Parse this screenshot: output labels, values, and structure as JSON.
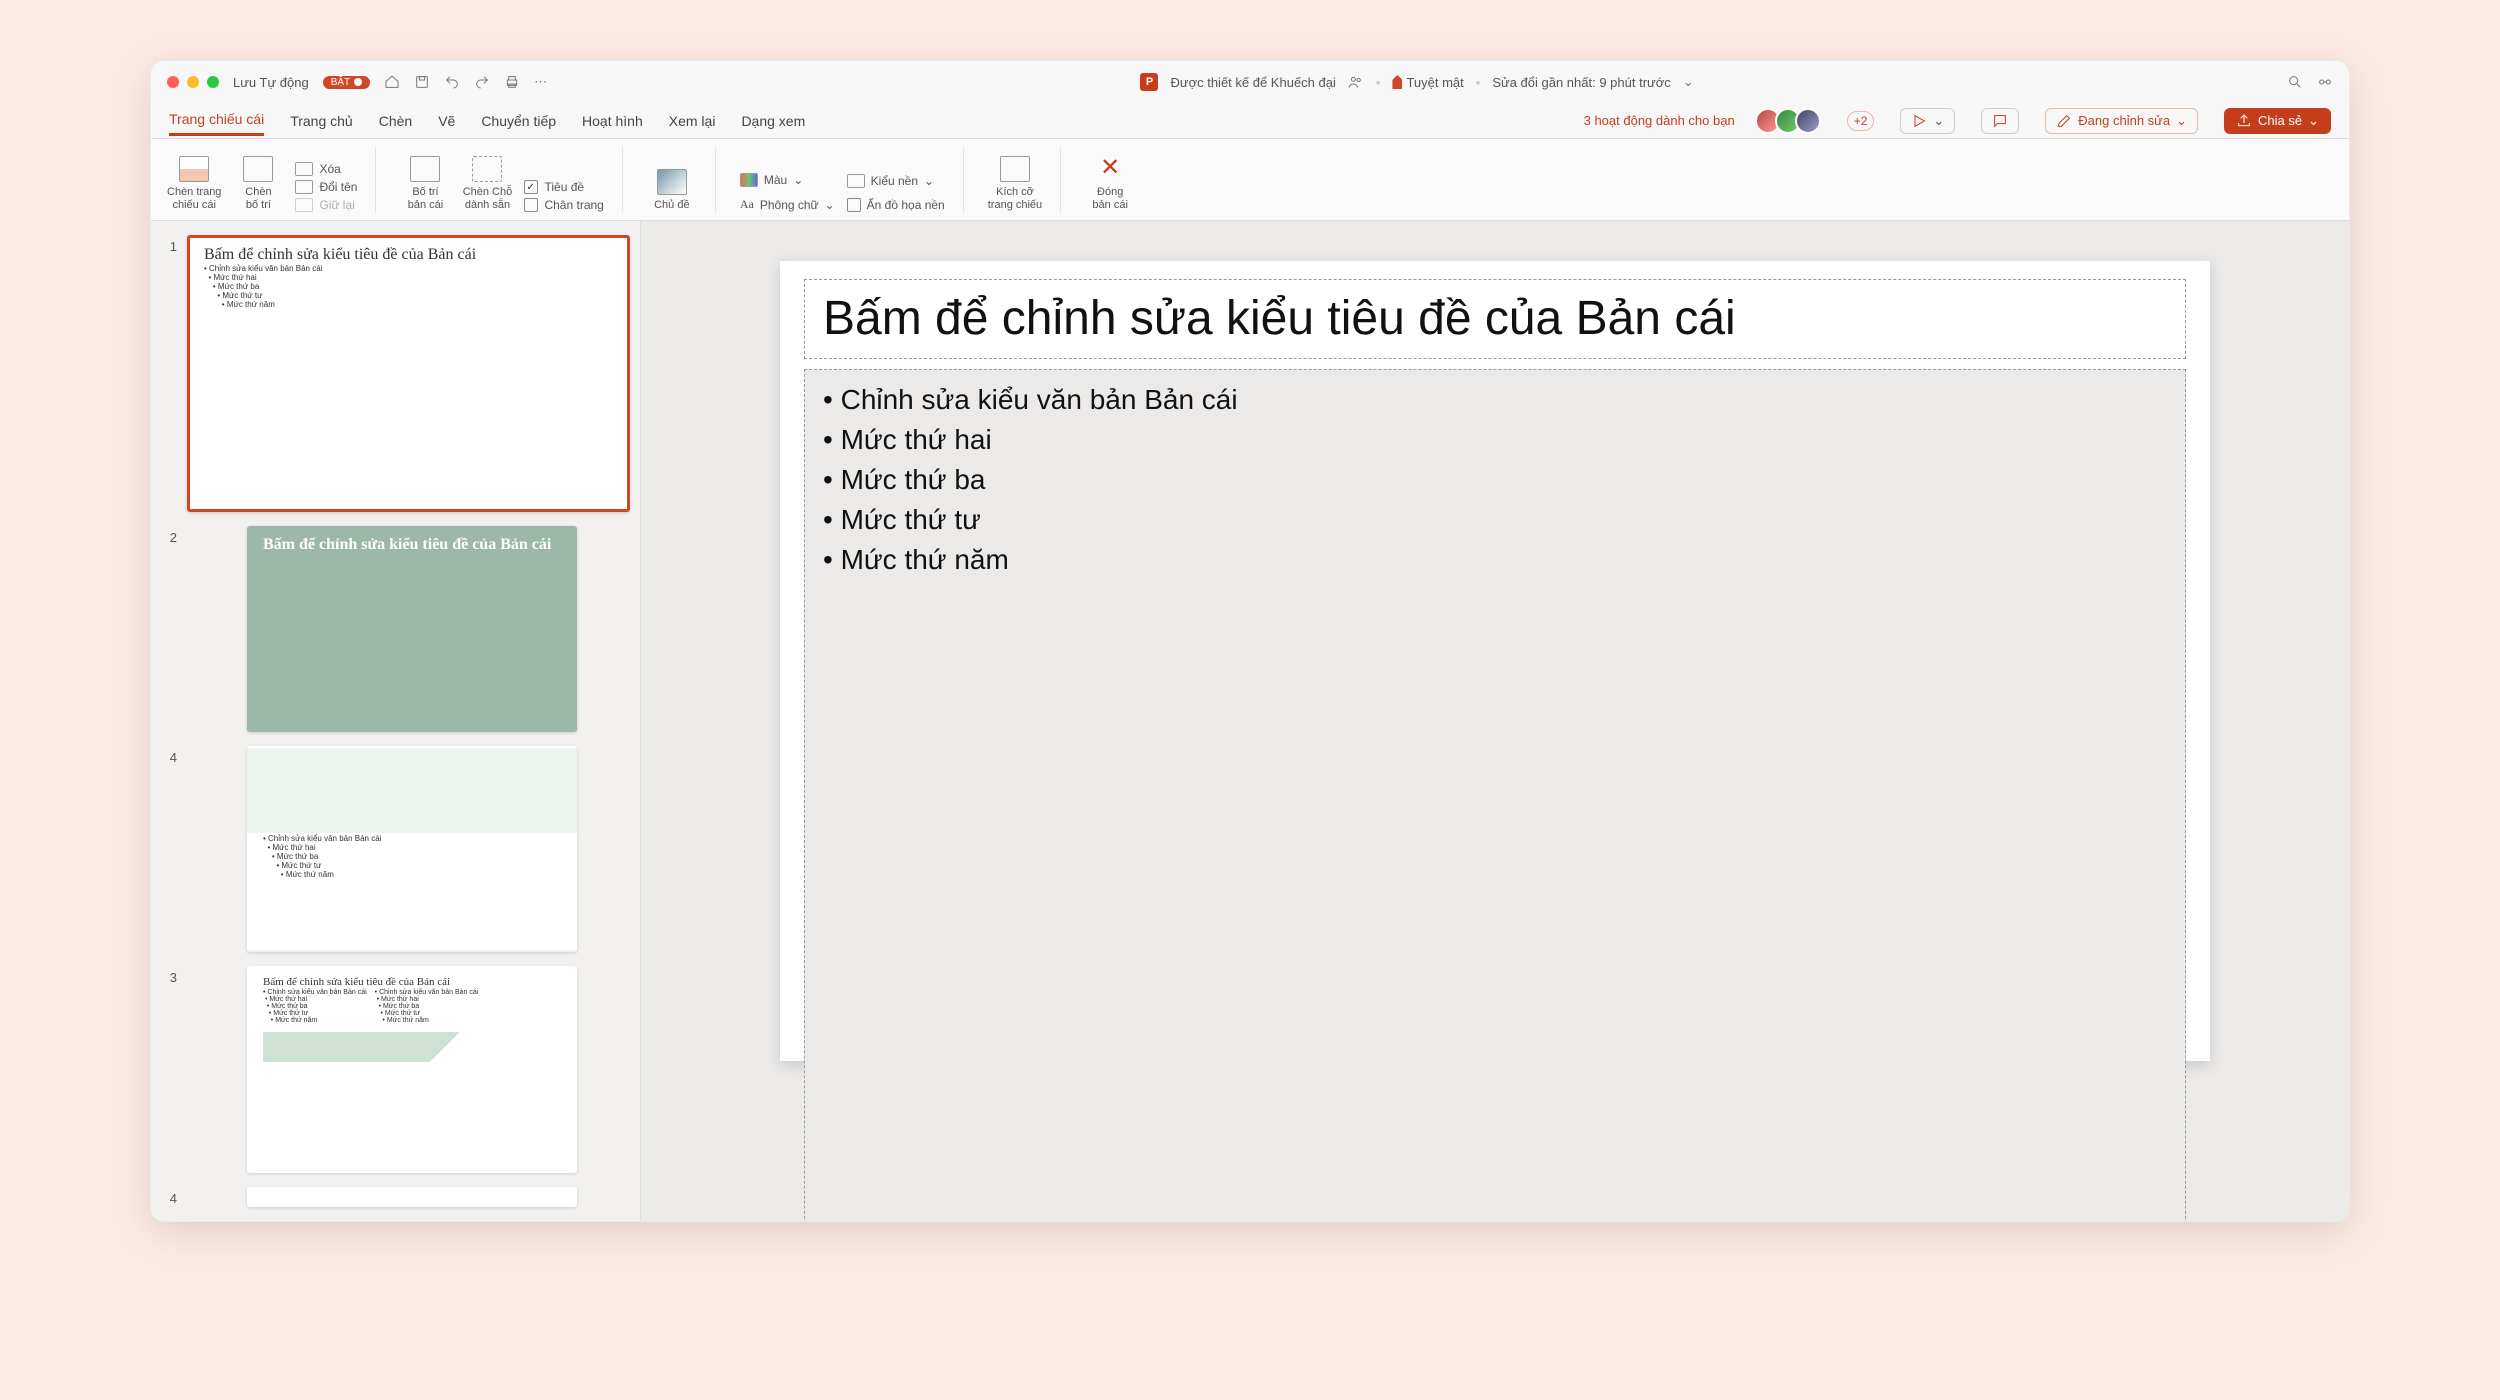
{
  "titlebar": {
    "autosave": "Lưu Tự động",
    "autosave_state": "BẬT",
    "app_icon": "P",
    "doc_title": "Được thiết kế để Khuếch đại",
    "sensitivity": "Tuyệt mật",
    "last_modified": "Sửa đổi gần nhất: 9 phút trước"
  },
  "tabs": {
    "items": [
      "Trang chiếu cái",
      "Trang chủ",
      "Chèn",
      "Vẽ",
      "Chuyển tiếp",
      "Hoạt hình",
      "Xem lại",
      "Dạng xem"
    ],
    "activity": "3 hoạt động dành cho bạn",
    "more_count": "+2",
    "editing": "Đang chỉnh sửa",
    "share": "Chia sẻ"
  },
  "ribbon": {
    "insert_master": "Chèn trang\nchiếu cái",
    "insert_layout": "Chèn\nbố trí",
    "delete": "Xóa",
    "rename": "Đổi tên",
    "preserve": "Giữ lại",
    "master_layout": "Bố trí\nbản cái",
    "insert_placeholder": "Chèn Chỗ\ndành sẵn",
    "title_chk": "Tiêu đề",
    "footer_chk": "Chân trang",
    "themes": "Chủ đề",
    "colors": "Màu",
    "fonts": "Phông chữ",
    "bg_styles": "Kiểu nền",
    "hide_bg": "Ẩn đồ họa nền",
    "slide_size": "Kích cỡ\ntrang chiếu",
    "close_master": "Đóng\nbản cái"
  },
  "slide": {
    "title": "Bấm để chỉnh sửa kiểu tiêu đề của Bản cái",
    "l1": "Chỉnh sửa kiểu văn bản Bản cái",
    "l2": "Mức thứ hai",
    "l3": "Mức thứ ba",
    "l4": "Mức thứ tư",
    "l5": "Mức thứ năm"
  },
  "thumbs": {
    "n1": "1",
    "n2": "2",
    "n3": "4",
    "n4": "3",
    "n5": "4"
  }
}
